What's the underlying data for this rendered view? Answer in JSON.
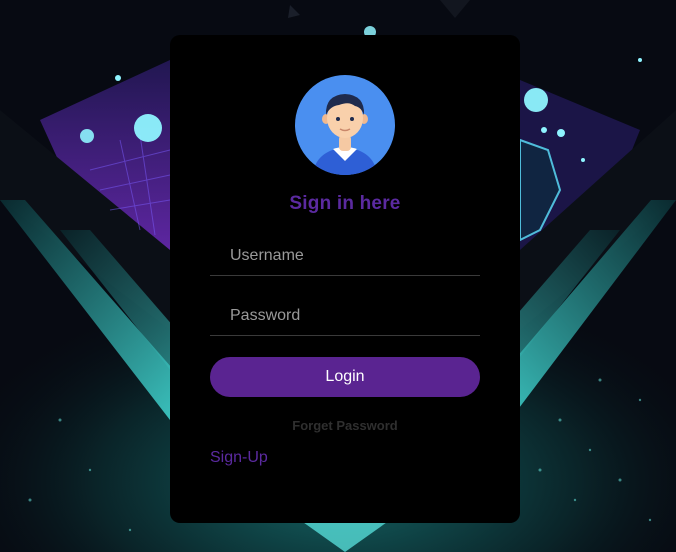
{
  "login_card": {
    "title": "Sign in here",
    "username_placeholder": "Username",
    "password_placeholder": "Password",
    "login_label": "Login",
    "forget_password_label": "Forget Password",
    "signup_label": "Sign-Up"
  },
  "colors": {
    "accent_purple": "#5a2491",
    "card_background": "#000000",
    "avatar_circle": "#4a8ff0"
  },
  "icons": {
    "avatar": "user-avatar-icon"
  }
}
